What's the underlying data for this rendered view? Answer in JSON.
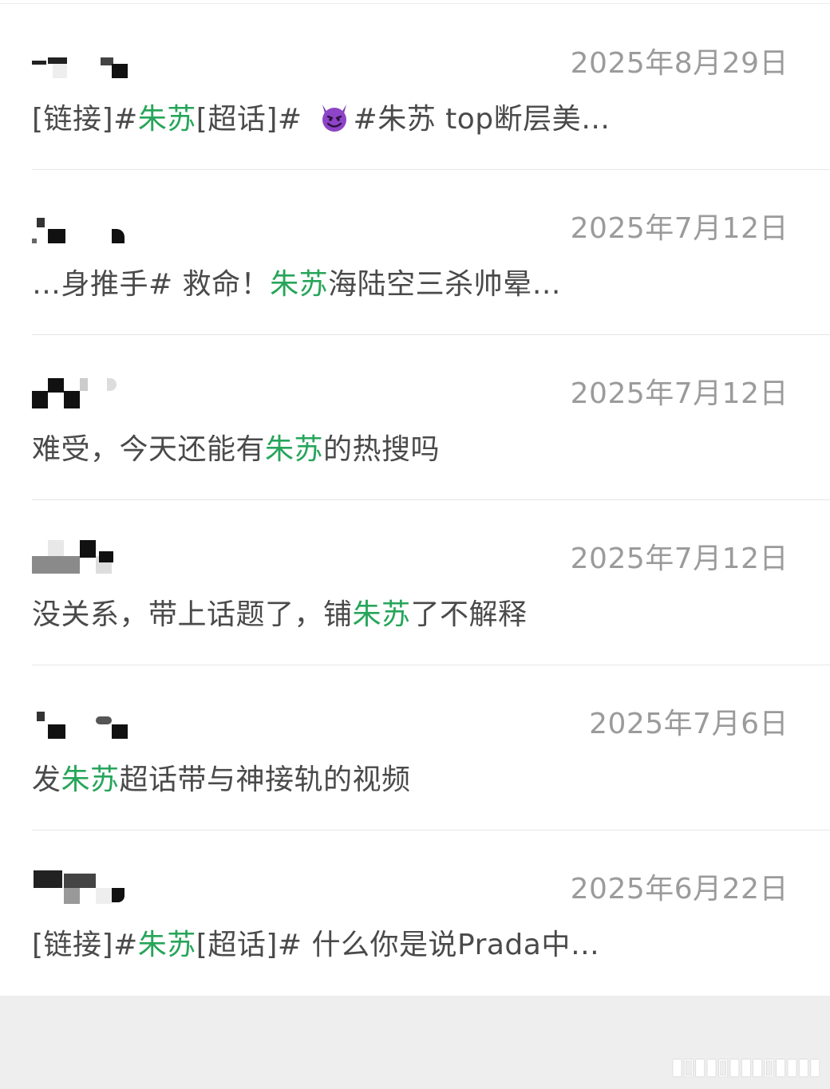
{
  "comments": [
    {
      "date": "2025年8月29日",
      "parts": [
        {
          "text": "[链接]#",
          "hl": false
        },
        {
          "text": "朱苏",
          "hl": true
        },
        {
          "text": "[超话]#",
          "hl": false
        },
        {
          "text": "__devil__",
          "hl": false
        },
        {
          "text": "#朱苏 top断层美…",
          "hl": false
        }
      ]
    },
    {
      "date": "2025年7月12日",
      "parts": [
        {
          "text": "…身推手# 救命！",
          "hl": false
        },
        {
          "text": "朱苏",
          "hl": true
        },
        {
          "text": "海陆空三杀帅晕…",
          "hl": false
        }
      ]
    },
    {
      "date": "2025年7月12日",
      "parts": [
        {
          "text": "难受，今天还能有",
          "hl": false
        },
        {
          "text": "朱苏",
          "hl": true
        },
        {
          "text": "的热搜吗",
          "hl": false
        }
      ]
    },
    {
      "date": "2025年7月12日",
      "parts": [
        {
          "text": "没关系，带上话题了，铺",
          "hl": false
        },
        {
          "text": "朱苏",
          "hl": true
        },
        {
          "text": "了不解释",
          "hl": false
        }
      ]
    },
    {
      "date": "2025年7月6日",
      "parts": [
        {
          "text": "发",
          "hl": false
        },
        {
          "text": "朱苏",
          "hl": true
        },
        {
          "text": "超话带与神接轨的视频",
          "hl": false
        }
      ]
    },
    {
      "date": "2025年6月22日",
      "parts": [
        {
          "text": "[链接]#",
          "hl": false
        },
        {
          "text": "朱苏",
          "hl": true
        },
        {
          "text": "[超话]#",
          "hl": false
        },
        {
          "text": " 什么你是说Prada中…",
          "hl": false
        }
      ]
    }
  ],
  "emoji": {
    "devil": "smiling-face-with-horns-icon"
  },
  "colors": {
    "highlight": "#27a55a",
    "text": "#4a4a4a",
    "date": "#9b9b9b"
  }
}
